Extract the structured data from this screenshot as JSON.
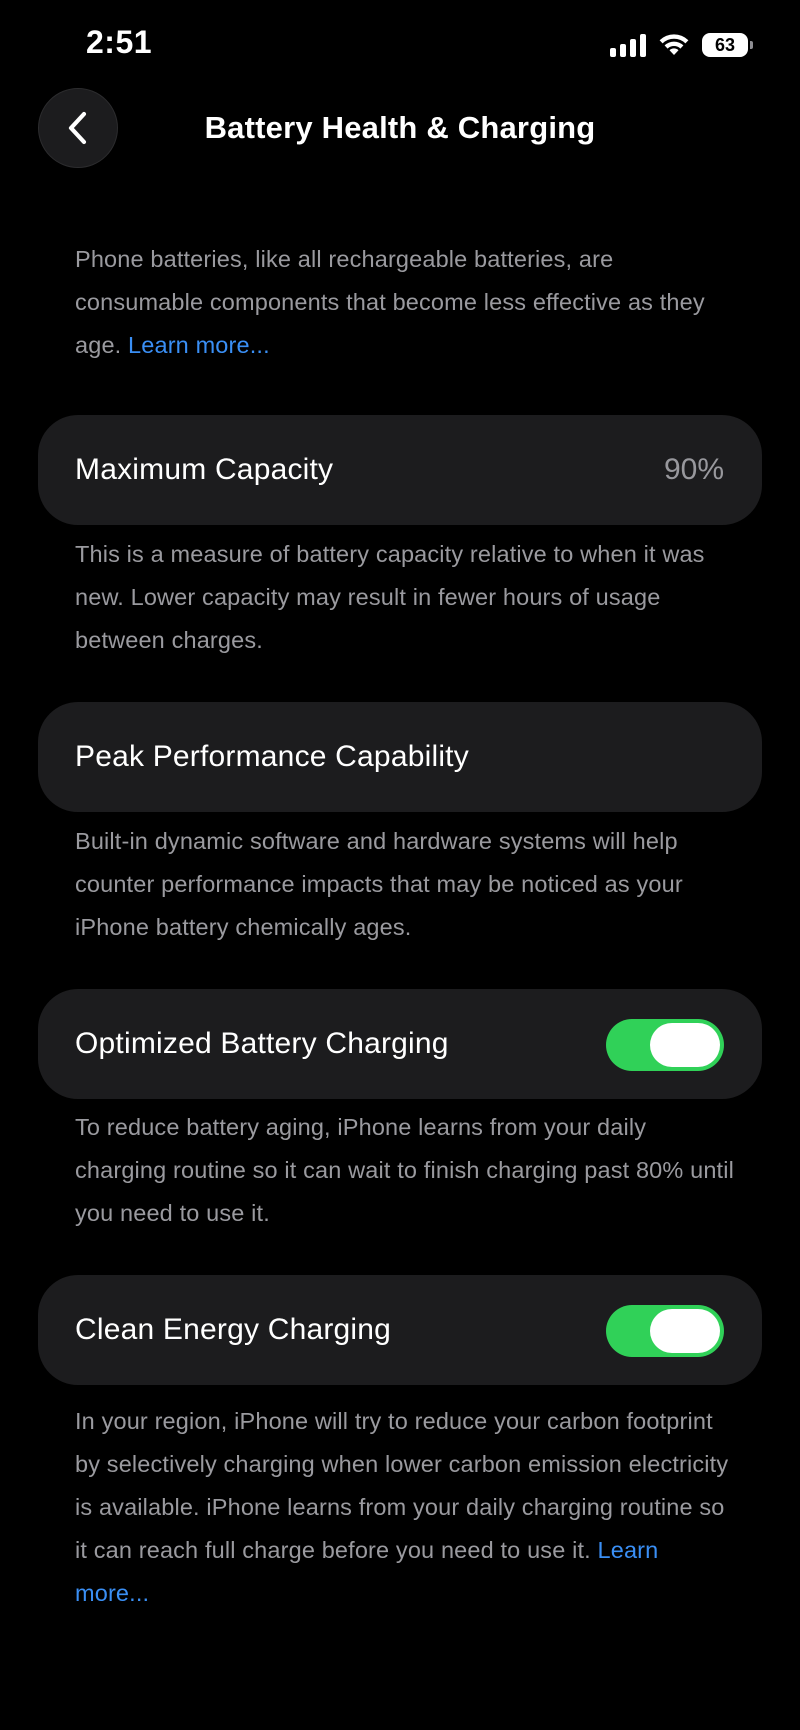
{
  "status_bar": {
    "time": "2:51",
    "battery_level": "63",
    "signal_bars": 4,
    "icons": [
      "cellular-signal-icon",
      "wifi-icon",
      "battery-icon"
    ]
  },
  "nav": {
    "title": "Battery Health & Charging",
    "back_icon": "chevron-left-icon"
  },
  "intro": {
    "text": "Phone batteries, like all rechargeable batteries, are consumable components that become less effective as they age. ",
    "link": "Learn more..."
  },
  "maximum_capacity": {
    "label": "Maximum Capacity",
    "value": "90%",
    "description": "This is a measure of battery capacity relative to when it was new. Lower capacity may result in fewer hours of usage between charges."
  },
  "peak_performance": {
    "label": "Peak Performance Capability",
    "description": "Built-in dynamic software and hardware systems will help counter performance impacts that may be noticed as your iPhone battery chemically ages."
  },
  "optimized_charging": {
    "label": "Optimized Battery Charging",
    "enabled": true,
    "description": "To reduce battery aging, iPhone learns from your daily charging routine so it can wait to finish charging past 80% until you need to use it."
  },
  "clean_energy": {
    "label": "Clean Energy Charging",
    "enabled": true,
    "description": "In your region, iPhone will try to reduce your carbon footprint by selectively charging when lower carbon emission electricity is available. iPhone learns from your daily charging routine so it can reach full charge before you need to use it. ",
    "link": "Learn more..."
  },
  "colors": {
    "background": "#000000",
    "card": "#1c1c1e",
    "secondary_text": "#9a9a9f",
    "link": "#3a8ff5",
    "toggle_on": "#30d158"
  }
}
